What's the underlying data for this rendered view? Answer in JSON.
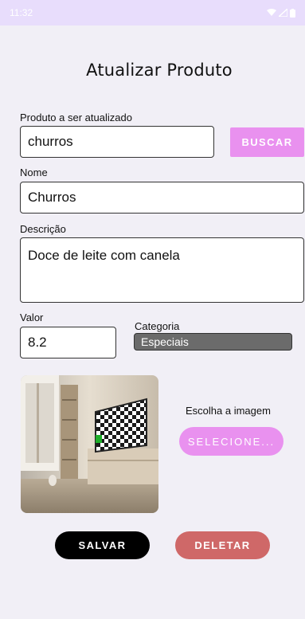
{
  "status_bar": {
    "time": "11:32"
  },
  "screen": {
    "title": "Atualizar Produto"
  },
  "search": {
    "label": "Produto a ser atualizado",
    "value": "churros",
    "button_label": "BUSCAR"
  },
  "form": {
    "name_label": "Nome",
    "name_value": "Churros",
    "description_label": "Descrição",
    "description_value": "Doce de leite com canela",
    "price_label": "Valor",
    "price_value": "8.2",
    "category_label": "Categoria",
    "category_value": "Especiais"
  },
  "image_picker": {
    "prompt": "Escolha a imagem",
    "button_label": "SELECIONE..."
  },
  "actions": {
    "save_label": "SALVAR",
    "delete_label": "DELETAR"
  },
  "colors": {
    "accent": "#e991ef",
    "delete": "#cf6868",
    "status_bar": "#e8ddfc",
    "background": "#f1eff6"
  }
}
